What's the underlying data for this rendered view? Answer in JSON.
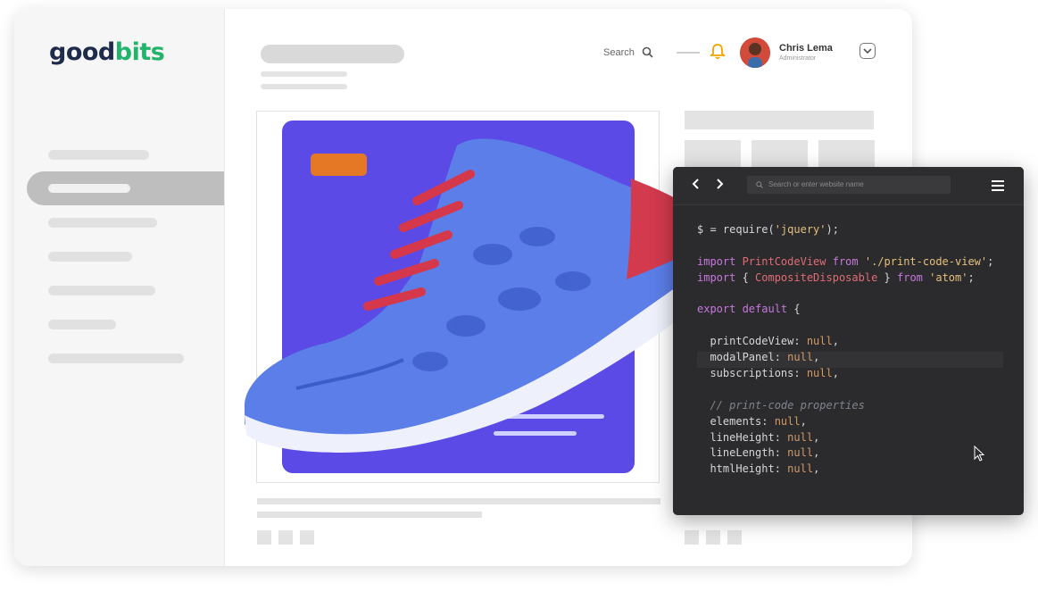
{
  "logo": {
    "part1": "good",
    "part2": "bits"
  },
  "header": {
    "search_label": "Search",
    "user_name": "Chris Lema",
    "user_role": "Administrator"
  },
  "code_window": {
    "address_placeholder": "Search or enter website name",
    "lines": [
      [
        {
          "t": "$ = require(",
          "c": ""
        },
        {
          "t": "'jquery'",
          "c": "str"
        },
        {
          "t": ");",
          "c": ""
        }
      ],
      [],
      [
        {
          "t": "import ",
          "c": "kw"
        },
        {
          "t": "PrintCodeView ",
          "c": "fn"
        },
        {
          "t": "from ",
          "c": "kw"
        },
        {
          "t": "'./print-code-view'",
          "c": "str"
        },
        {
          "t": ";",
          "c": ""
        }
      ],
      [
        {
          "t": "import ",
          "c": "kw"
        },
        {
          "t": "{ ",
          "c": ""
        },
        {
          "t": "CompositeDisposable",
          "c": "fn"
        },
        {
          "t": " } ",
          "c": ""
        },
        {
          "t": "from ",
          "c": "kw"
        },
        {
          "t": "'atom'",
          "c": "str"
        },
        {
          "t": ";",
          "c": ""
        }
      ],
      [],
      [
        {
          "t": "export default ",
          "c": "kw"
        },
        {
          "t": "{",
          "c": ""
        }
      ],
      [],
      [
        {
          "t": "  printCodeView: ",
          "c": ""
        },
        {
          "t": "null",
          "c": "nul"
        },
        {
          "t": ",",
          "c": ""
        }
      ],
      [
        {
          "t": "  modalPanel: ",
          "c": ""
        },
        {
          "t": "null",
          "c": "nul"
        },
        {
          "t": ",",
          "c": ""
        }
      ],
      [
        {
          "t": "  subscriptions: ",
          "c": ""
        },
        {
          "t": "null",
          "c": "nul"
        },
        {
          "t": ",",
          "c": ""
        }
      ],
      [],
      [
        {
          "t": "  // print-code properties",
          "c": "cm"
        }
      ],
      [
        {
          "t": "  elements: ",
          "c": ""
        },
        {
          "t": "null",
          "c": "nul"
        },
        {
          "t": ",",
          "c": ""
        }
      ],
      [
        {
          "t": "  lineHeight: ",
          "c": ""
        },
        {
          "t": "null",
          "c": "nul"
        },
        {
          "t": ",",
          "c": ""
        }
      ],
      [
        {
          "t": "  lineLength: ",
          "c": ""
        },
        {
          "t": "null",
          "c": "nul"
        },
        {
          "t": ",",
          "c": ""
        }
      ],
      [
        {
          "t": "  htmlHeight: ",
          "c": ""
        },
        {
          "t": "null",
          "c": "nul"
        },
        {
          "t": ",",
          "c": ""
        }
      ]
    ]
  },
  "colors": {
    "accent": "#5b4ae6",
    "tag": "#e47824",
    "brand_dark": "#1f2b4b",
    "brand_green": "#22b46b"
  }
}
